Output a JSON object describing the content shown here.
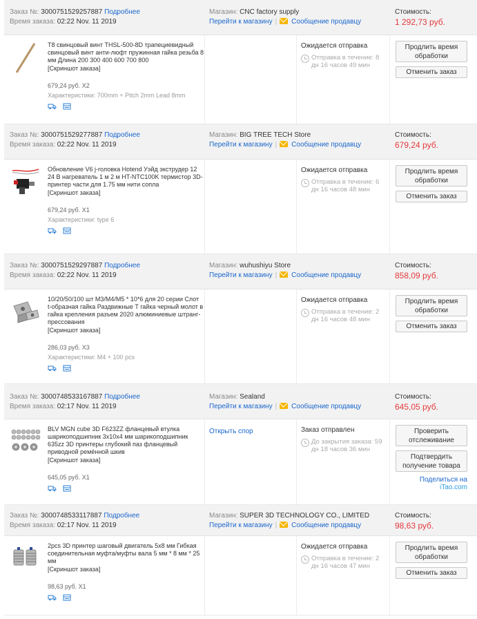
{
  "labels": {
    "order_no": "Заказ №:",
    "order_time": "Время заказа:",
    "details": "Подробнее",
    "shop": "Магазин:",
    "go_to_shop": "Перейти к магазину",
    "message_seller": "Сообщение продавцу",
    "cost": "Стоимость:",
    "screenshot": "[Скриншот заказа]",
    "specs": "Характеристики:",
    "extend_processing": "Продлить время обработки",
    "cancel_order": "Отменить заказ",
    "check_tracking": "Проверить отслеживание",
    "confirm_receipt": "Подтвердить получение товара",
    "share_on": "Поделиться на",
    "itao": "iTao.com"
  },
  "orders": [
    {
      "order_no": "3000751529257887",
      "order_time": "02:22 Nov. 11 2019",
      "shop": "CNC factory supply",
      "total": "1 292,73 руб.",
      "product": {
        "title": "T8 свинцовый винт THSL-500-8D трапециевидный свинцовый винт анти-люфт пружинная гайка резьба 8 мм Длина 200 300 400 600 700 800",
        "price_qty": "679,24 руб. X2",
        "specs": "700mm + Pitch 2mm Lead 8mm"
      },
      "status": "Ожидается отправка",
      "countdown": "Отправка в течение: 8 дн 16 часов 49 мин"
    },
    {
      "order_no": "3000751529277887",
      "order_time": "02:22 Nov. 11 2019",
      "shop": "BIG TREE TECH Store",
      "total": "679,24 руб.",
      "product": {
        "title": "Обновление V6 j-головка Hotend Уэйд экструдер 12 24 В нагреватель 1 м 2 м HT-NTC100K термистор 3D-принтер части для 1.75 мм нити сопла",
        "price_qty": "679,24 руб. X1",
        "specs": "type 6"
      },
      "status": "Ожидается отправка",
      "countdown": "Отправка в течение: 6 дн 16 часов 48 мин"
    },
    {
      "order_no": "3000751529297887",
      "order_time": "02:22 Nov. 11 2019",
      "shop": "wuhushiyu Store",
      "total": "858,09 руб.",
      "product": {
        "title": "10/20/50/100 шт M3/M4/M5 * 10*6 для 20 серии Слот t-образная гайка Раздвижные T гайка черный молот в гайка крепления разъем 2020 алюминиевые штранг-прессования",
        "price_qty": "286,03 руб. X3",
        "specs": "M4 + 100 pcs"
      },
      "status": "Ожидается отправка",
      "countdown": "Отправка в течение: 2 дн 16 часов 48 мин"
    },
    {
      "order_no": "3000748533167887",
      "order_time": "02:17 Nov. 11 2019",
      "shop": "Sealand",
      "total": "645,05 руб.",
      "product": {
        "title": "BLV MGN cube 3D F623ZZ фланцевый втулка шарикоподшипник 3x10x4 мм шарикоподшипник 635zz 3D принтеры глубокий паз фланцевый приводной ремённой шкив",
        "price_qty": "645,05 руб. X1",
        "specs": ""
      },
      "dispute": "Открыть спор",
      "status": "Заказ отправлен",
      "countdown": "До закрытия заказа: 59 дн 18 часов 36 мин"
    },
    {
      "order_no": "3000748533117887",
      "order_time": "02:17 Nov. 11 2019",
      "shop": "SUPER 3D TECHNOLOGY CO., LIMITED",
      "total": "98,63 руб.",
      "product": {
        "title": "2pcs 3D принтер шаговый двигатель 5x8 мм Гибкая соединительная муфта/муфты вала 5 мм * 8 мм * 25 мм",
        "price_qty": "98,63 руб. X1",
        "specs": ""
      },
      "status": "Ожидается отправка",
      "countdown": "Отправка в течение: 2 дн 16 часов 47 мин"
    }
  ]
}
